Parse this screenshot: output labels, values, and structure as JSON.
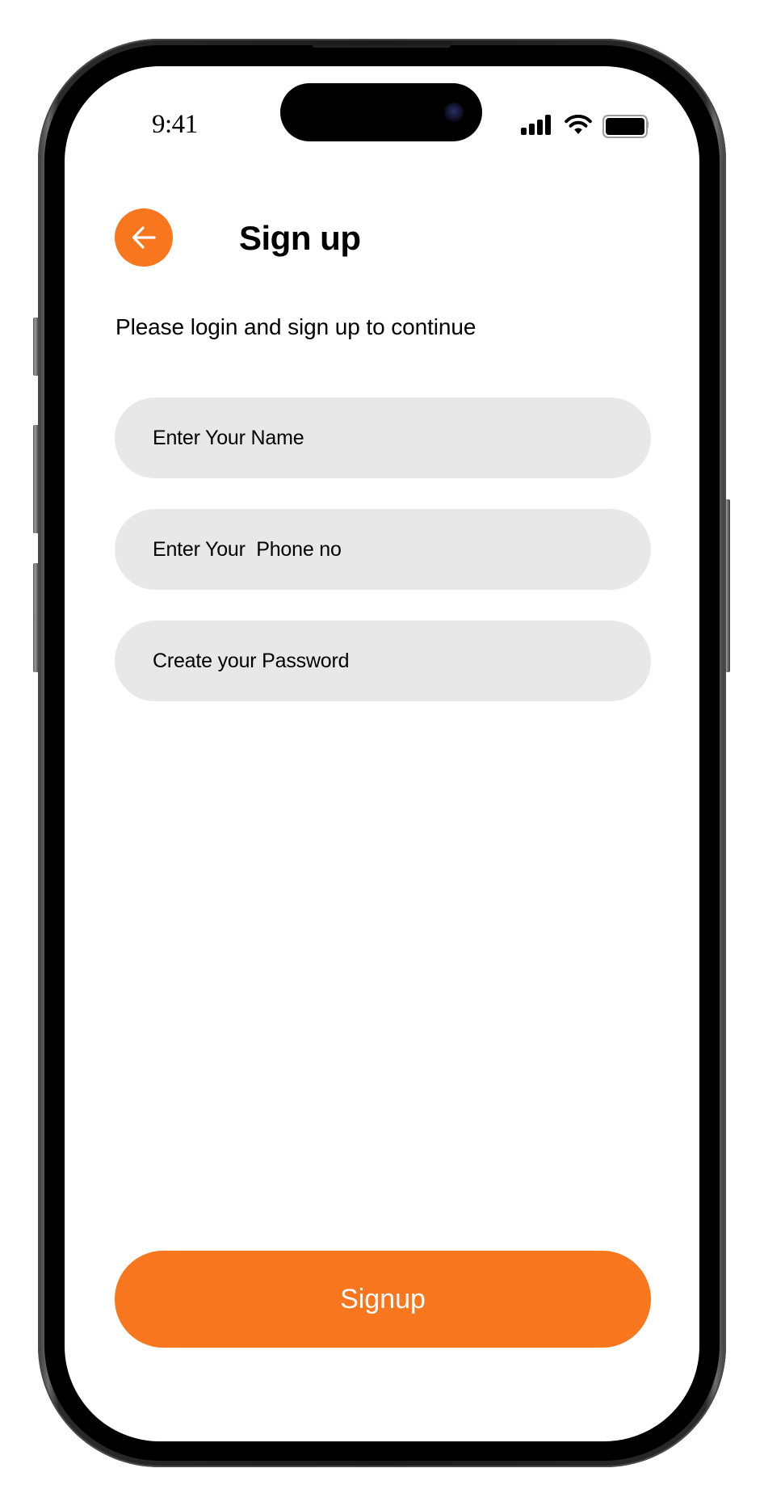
{
  "status_bar": {
    "time": "9:41",
    "icons": [
      "cellular-signal-icon",
      "wifi-icon",
      "battery-icon"
    ]
  },
  "header": {
    "back_icon": "arrow-left-icon",
    "title": "Sign up"
  },
  "subtitle": "Please login and sign up to continue",
  "form": {
    "fields": [
      {
        "name": "name",
        "placeholder": "Enter Your Name",
        "value": ""
      },
      {
        "name": "phone",
        "placeholder": "Enter Your  Phone no",
        "value": ""
      },
      {
        "name": "password",
        "placeholder": "Create your Password",
        "value": ""
      }
    ],
    "submit_label": "Signup"
  },
  "colors": {
    "accent": "#F8761E",
    "input_background": "#E8E8E8",
    "text": "#000000"
  }
}
